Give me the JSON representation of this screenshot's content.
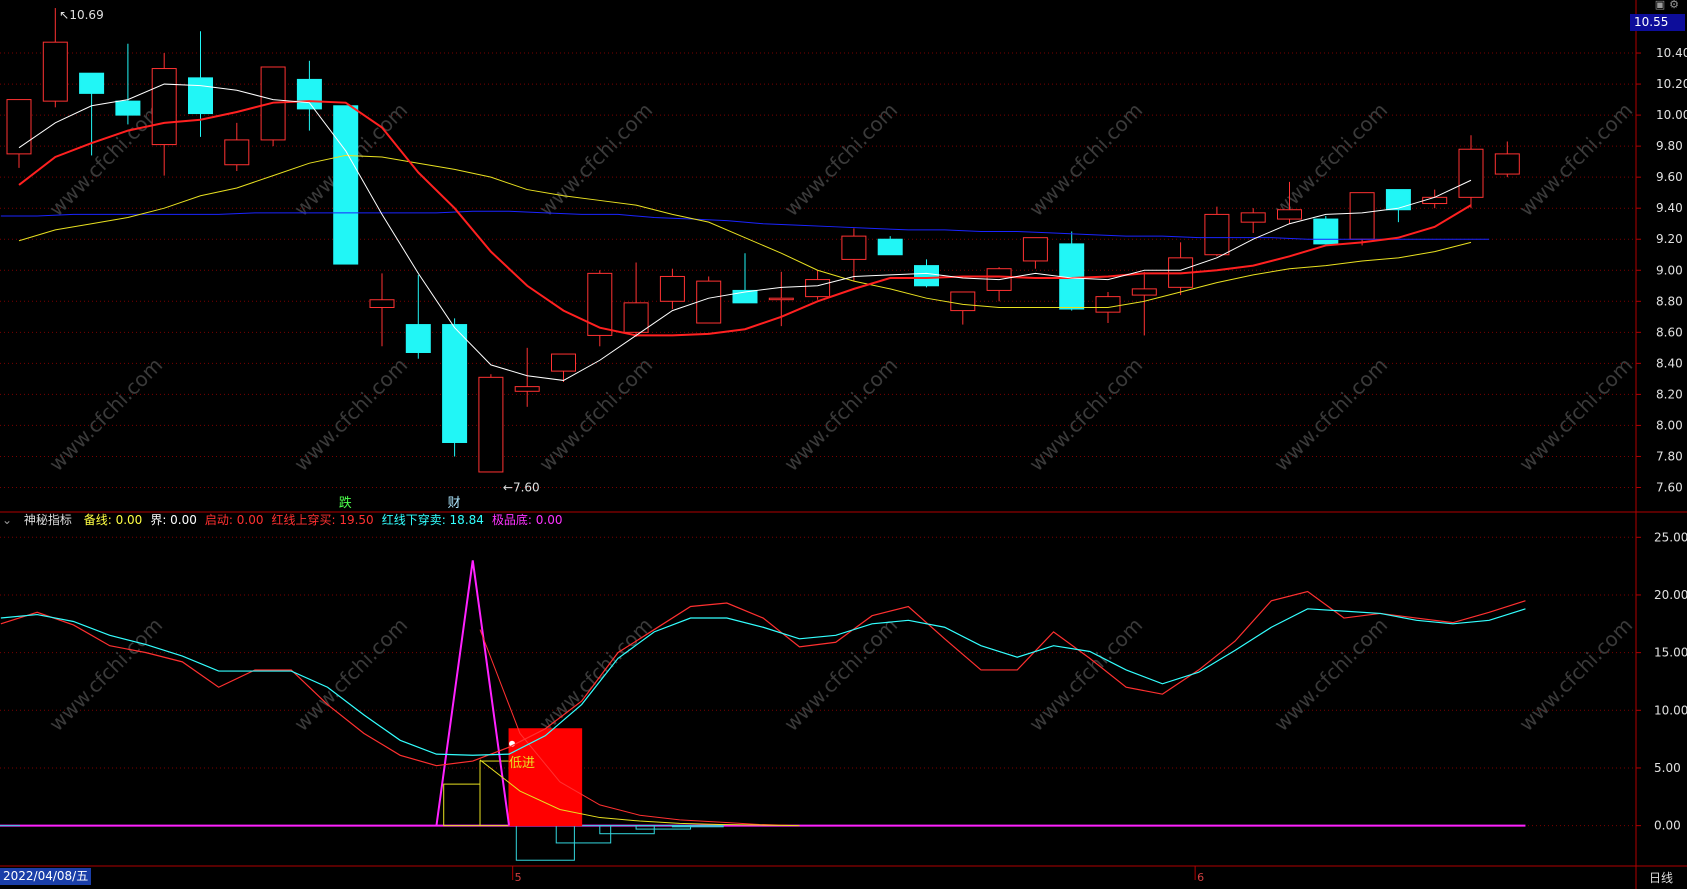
{
  "header": {
    "title": "",
    "close_icon": "close-icon",
    "menu_icon": "menu-icon"
  },
  "current_price_tag": "10.55",
  "date_label": "2022/04/08/五",
  "period_label": "日线",
  "month_marks": [
    "5",
    "6"
  ],
  "watermark": "www.cfchi.com",
  "main_chart": {
    "high_label": "10.69",
    "low_label": "7.60",
    "signal_labels": [
      {
        "text": "跌",
        "index": 9,
        "color": "#4cff4c"
      },
      {
        "text": "财",
        "index": 12,
        "color": "#aee7ff"
      }
    ],
    "y_ticks": [
      "7.60",
      "7.80",
      "8.00",
      "8.20",
      "8.40",
      "8.60",
      "8.80",
      "9.00",
      "9.20",
      "9.40",
      "9.60",
      "9.80",
      "10.00",
      "10.20",
      "10.40"
    ]
  },
  "indicator": {
    "name": "神秘指标",
    "values": [
      {
        "label": "备线:",
        "value": "0.00",
        "color": "#ffff44"
      },
      {
        "label": "界:",
        "value": "0.00",
        "color": "#ffffff"
      },
      {
        "label": "启动:",
        "value": "0.00",
        "color": "#ff3030"
      },
      {
        "label": "红线上穿买:",
        "value": "19.50",
        "color": "#ff3030"
      },
      {
        "label": "红线下穿卖:",
        "value": "18.84",
        "color": "#33ffff"
      },
      {
        "label": "极品底:",
        "value": "0.00",
        "color": "#ff33ff"
      }
    ],
    "y_ticks": [
      "0.00",
      "5.00",
      "10.00",
      "15.00",
      "20.00",
      "25.00"
    ],
    "annotation": "低进"
  },
  "colors": {
    "up": "#ff3232",
    "down": "#21f6f6",
    "ma5": "#ffffff",
    "ma10": "#ff2020",
    "ma20": "#e8e020",
    "ma60": "#1a24ff",
    "grid": "#7a0000",
    "axis": "#b00000",
    "magenta": "#ff22ff",
    "cyan": "#33d6dd"
  },
  "chart_data": [
    {
      "type": "candlestick",
      "title": "",
      "ylim": [
        7.5,
        10.6
      ],
      "candles": [
        {
          "o": 9.75,
          "h": 9.85,
          "l": 9.66,
          "c": 10.1
        },
        {
          "o": 10.09,
          "h": 10.69,
          "l": 10.05,
          "c": 10.47
        },
        {
          "o": 10.27,
          "h": 10.25,
          "l": 9.74,
          "c": 10.14
        },
        {
          "o": 10.09,
          "h": 10.46,
          "l": 9.94,
          "c": 10.0
        },
        {
          "o": 9.81,
          "h": 10.4,
          "l": 9.61,
          "c": 10.3
        },
        {
          "o": 10.24,
          "h": 10.54,
          "l": 9.86,
          "c": 10.01
        },
        {
          "o": 9.68,
          "h": 9.95,
          "l": 9.64,
          "c": 9.84
        },
        {
          "o": 9.84,
          "h": 10.3,
          "l": 9.8,
          "c": 10.31
        },
        {
          "o": 10.23,
          "h": 10.35,
          "l": 9.9,
          "c": 10.04
        },
        {
          "o": 10.06,
          "h": 10.06,
          "l": 9.04,
          "c": 9.04
        },
        {
          "o": 8.76,
          "h": 8.98,
          "l": 8.51,
          "c": 8.81
        },
        {
          "o": 8.65,
          "h": 8.97,
          "l": 8.43,
          "c": 8.47
        },
        {
          "o": 8.65,
          "h": 8.69,
          "l": 7.8,
          "c": 7.89
        },
        {
          "o": 7.7,
          "h": 8.33,
          "l": 7.7,
          "c": 8.31
        },
        {
          "o": 8.22,
          "h": 8.5,
          "l": 8.12,
          "c": 8.25
        },
        {
          "o": 8.35,
          "h": 8.45,
          "l": 8.28,
          "c": 8.46
        },
        {
          "o": 8.58,
          "h": 9.0,
          "l": 8.51,
          "c": 8.98
        },
        {
          "o": 8.6,
          "h": 9.05,
          "l": 8.57,
          "c": 8.79
        },
        {
          "o": 8.8,
          "h": 9.01,
          "l": 8.75,
          "c": 8.96
        },
        {
          "o": 8.66,
          "h": 8.96,
          "l": 8.66,
          "c": 8.93
        },
        {
          "o": 8.87,
          "h": 9.11,
          "l": 8.79,
          "c": 8.79
        },
        {
          "o": 8.82,
          "h": 8.99,
          "l": 8.64,
          "c": 8.82
        },
        {
          "o": 8.83,
          "h": 9.0,
          "l": 8.81,
          "c": 8.94
        },
        {
          "o": 9.07,
          "h": 9.27,
          "l": 8.93,
          "c": 9.22
        },
        {
          "o": 9.2,
          "h": 9.22,
          "l": 9.13,
          "c": 9.1
        },
        {
          "o": 9.03,
          "h": 9.07,
          "l": 8.89,
          "c": 8.9
        },
        {
          "o": 8.74,
          "h": 8.86,
          "l": 8.65,
          "c": 8.86
        },
        {
          "o": 8.87,
          "h": 9.02,
          "l": 8.8,
          "c": 9.01
        },
        {
          "o": 9.06,
          "h": 9.2,
          "l": 9.01,
          "c": 9.21
        },
        {
          "o": 9.17,
          "h": 9.25,
          "l": 8.74,
          "c": 8.75
        },
        {
          "o": 8.73,
          "h": 8.86,
          "l": 8.66,
          "c": 8.83
        },
        {
          "o": 8.84,
          "h": 8.99,
          "l": 8.58,
          "c": 8.88
        },
        {
          "o": 8.89,
          "h": 9.18,
          "l": 8.84,
          "c": 9.08
        },
        {
          "o": 9.1,
          "h": 9.41,
          "l": 9.09,
          "c": 9.36
        },
        {
          "o": 9.31,
          "h": 9.4,
          "l": 9.24,
          "c": 9.37
        },
        {
          "o": 9.33,
          "h": 9.57,
          "l": 9.3,
          "c": 9.39
        },
        {
          "o": 9.33,
          "h": 9.35,
          "l": 9.17,
          "c": 9.17
        },
        {
          "o": 9.2,
          "h": 9.5,
          "l": 9.16,
          "c": 9.5
        },
        {
          "o": 9.52,
          "h": 9.5,
          "l": 9.31,
          "c": 9.39
        },
        {
          "o": 9.43,
          "h": 9.52,
          "l": 9.4,
          "c": 9.47
        },
        {
          "o": 9.47,
          "h": 9.87,
          "l": 9.4,
          "c": 9.78
        },
        {
          "o": 9.62,
          "h": 9.83,
          "l": 9.6,
          "c": 9.75
        }
      ],
      "ma5": [
        9.79,
        9.95,
        10.06,
        10.1,
        10.2,
        10.19,
        10.16,
        10.1,
        10.08,
        9.77,
        9.36,
        8.98,
        8.63,
        8.39,
        8.32,
        8.29,
        8.42,
        8.58,
        8.74,
        8.82,
        8.86,
        8.89,
        8.9,
        8.96,
        8.97,
        8.98,
        8.95,
        8.94,
        8.98,
        8.95,
        8.94,
        9.0,
        9.0,
        9.08,
        9.2,
        9.3,
        9.36,
        9.37,
        9.4,
        9.47,
        9.58
      ],
      "ma10": [
        9.55,
        9.73,
        9.82,
        9.9,
        9.95,
        9.97,
        10.02,
        10.08,
        10.09,
        10.08,
        9.92,
        9.63,
        9.4,
        9.12,
        8.9,
        8.74,
        8.63,
        8.58,
        8.58,
        8.59,
        8.62,
        8.7,
        8.8,
        8.88,
        8.95,
        8.95,
        8.96,
        8.96,
        8.95,
        8.95,
        8.96,
        8.98,
        8.98,
        9.0,
        9.03,
        9.09,
        9.16,
        9.18,
        9.21,
        9.28,
        9.42
      ],
      "ma20": [
        9.19,
        9.26,
        9.3,
        9.34,
        9.4,
        9.48,
        9.53,
        9.61,
        9.69,
        9.74,
        9.73,
        9.69,
        9.65,
        9.6,
        9.52,
        9.48,
        9.45,
        9.42,
        9.36,
        9.31,
        9.21,
        9.11,
        9.0,
        8.93,
        8.88,
        8.82,
        8.78,
        8.76,
        8.76,
        8.76,
        8.76,
        8.8,
        8.86,
        8.92,
        8.97,
        9.01,
        9.03,
        9.06,
        9.08,
        9.12,
        9.18
      ],
      "ma60": [
        9.35,
        9.35,
        9.36,
        9.36,
        9.36,
        9.36,
        9.36,
        9.37,
        9.37,
        9.37,
        9.37,
        9.37,
        9.37,
        9.38,
        9.38,
        9.37,
        9.36,
        9.36,
        9.34,
        9.33,
        9.32,
        9.3,
        9.29,
        9.28,
        9.27,
        9.26,
        9.26,
        9.25,
        9.25,
        9.24,
        9.23,
        9.22,
        9.22,
        9.21,
        9.21,
        9.21,
        9.2,
        9.2,
        9.2,
        9.2,
        9.2
      ]
    },
    {
      "type": "line",
      "title": "",
      "ylim": [
        -3.5,
        26.5
      ],
      "series": [
        {
          "name": "红线上穿买",
          "color": "#ff3030",
          "values": [
            17.5,
            18.5,
            17.4,
            15.6,
            15.0,
            14.2,
            12.0,
            13.5,
            13.5,
            10.5,
            8.0,
            6.1,
            5.2,
            5.6,
            6.8,
            8.4,
            10.8,
            15.0,
            17.0,
            19.0,
            19.3,
            18.0,
            15.5,
            15.9,
            18.2,
            19.0,
            16.2,
            13.5,
            13.5,
            16.8,
            14.5,
            12.0,
            11.4,
            13.5,
            16.0,
            19.5,
            20.3,
            18.0,
            18.4,
            18.0,
            17.6,
            18.5,
            19.5
          ]
        },
        {
          "name": "红线下穿卖",
          "color": "#33ffff",
          "values": [
            18.0,
            18.3,
            17.7,
            16.5,
            15.7,
            14.7,
            13.4,
            13.4,
            13.4,
            12.0,
            9.6,
            7.4,
            6.2,
            6.1,
            6.2,
            7.8,
            10.5,
            14.5,
            16.8,
            18.0,
            18.0,
            17.2,
            16.2,
            16.5,
            17.5,
            17.8,
            17.2,
            15.6,
            14.6,
            15.6,
            15.1,
            13.5,
            12.3,
            13.3,
            15.2,
            17.2,
            18.8,
            18.6,
            18.4,
            17.8,
            17.5,
            17.8,
            18.8
          ]
        }
      ],
      "spike": {
        "peak": 23.0,
        "start": 11.5,
        "end": 13.5
      },
      "decay": [
        {
          "color": "#ff3030",
          "values": [
            17.0,
            8.0,
            3.8,
            1.8,
            0.9,
            0.5,
            0.3,
            0.1,
            0.0
          ]
        },
        {
          "color": "#e8e020",
          "values": [
            5.7,
            3.0,
            1.4,
            0.7,
            0.4,
            0.2,
            0.1,
            0.05,
            0.0
          ]
        }
      ],
      "low_box": {
        "x0": 13.5,
        "x1": 15.5,
        "top": 8.4
      },
      "histogram": [
        {
          "x0": 11.7,
          "x1": 12.7,
          "top": 3.6,
          "color": "#e8e020"
        },
        {
          "x0": 12.7,
          "x1": 13.5,
          "top": 5.6,
          "color": "#e8e020"
        },
        {
          "x0": 13.7,
          "x1": 15.3,
          "top": -3.0,
          "color": "#33d6dd"
        },
        {
          "x0": 14.8,
          "x1": 16.3,
          "top": -1.5,
          "color": "#33d6dd"
        },
        {
          "x0": 16.0,
          "x1": 17.5,
          "top": -0.7,
          "color": "#33d6dd"
        },
        {
          "x0": 17.0,
          "x1": 18.5,
          "top": -0.3,
          "color": "#33d6dd"
        },
        {
          "x0": 18.0,
          "x1": 19.4,
          "top": -0.1,
          "color": "#33d6dd"
        }
      ]
    }
  ]
}
